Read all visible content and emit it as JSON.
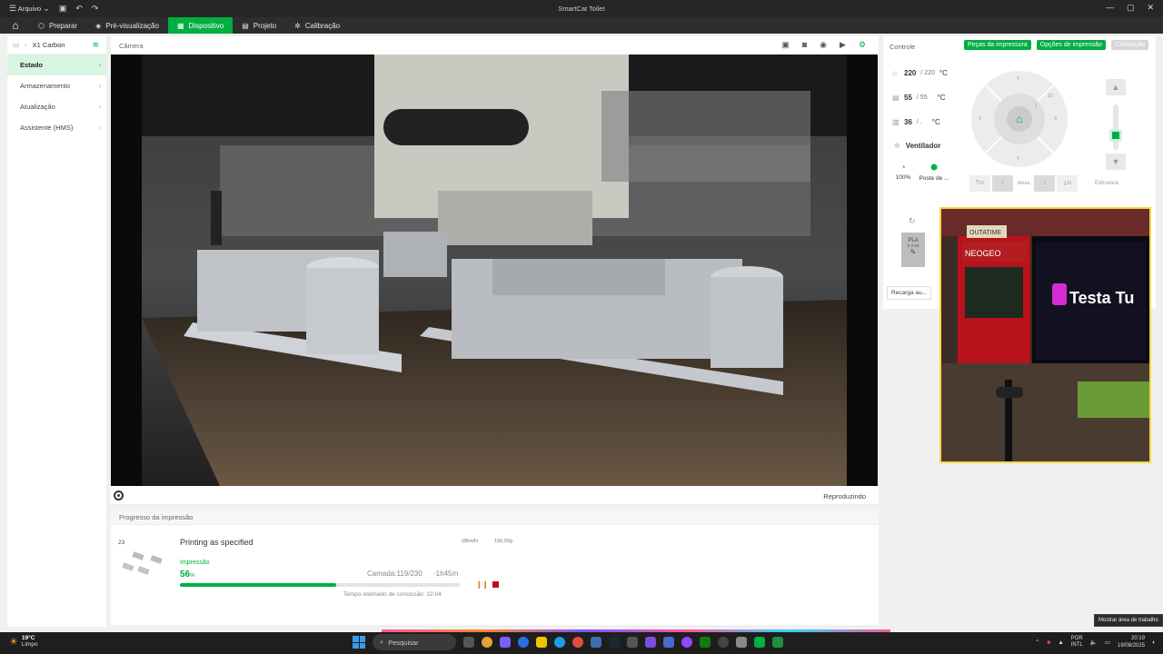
{
  "window": {
    "title": "SmartCat Toilet",
    "menu_label": "Arquivo"
  },
  "nav": {
    "tabs": [
      {
        "label": "Preparar"
      },
      {
        "label": "Pré-visualização"
      },
      {
        "label": "Dispositivo"
      },
      {
        "label": "Projeto"
      },
      {
        "label": "Calibração"
      }
    ],
    "active_tab": "Dispositivo"
  },
  "sidebar": {
    "device_name": "X1 Carbon",
    "items": [
      {
        "label": "Estado"
      },
      {
        "label": "Armazenamento"
      },
      {
        "label": "Atualização"
      },
      {
        "label": "Assistente (HMS)"
      }
    ]
  },
  "camera": {
    "title": "Câmera",
    "status": "Reproduzindo",
    "icons": [
      "snapshot-icon",
      "record-icon",
      "camera-switch-icon",
      "timelapse-icon",
      "settings-icon"
    ]
  },
  "progress": {
    "title": "Progresso da impressão",
    "plate_number": "23",
    "job_name": "Printing as specified",
    "meta_length": "(86m/fs",
    "meta_weight": "156,93g",
    "phase_label": "Impressão",
    "percent_value": "56",
    "percent_unit": "%",
    "percent": 56,
    "layer_text": "Camada:119/230",
    "remaining": "-1h45m",
    "eta": "Tempo estimado de conclusão: 22:04"
  },
  "controls": {
    "title": "Controle",
    "buttons": {
      "parts": "Peças da impressora",
      "options": "Opções de impressão",
      "calibration": "Calibração"
    },
    "nozzle": {
      "current": "220",
      "target": "/ 220",
      "unit": "°C"
    },
    "bed": {
      "current": "55",
      "target": "/ 55",
      "unit": "°C"
    },
    "chamber": {
      "current": "36",
      "target": "/ .",
      "unit": "°C"
    },
    "fan_title": "Ventilador",
    "fan_speed": "100%",
    "fan_mode": "Poste de ...",
    "bed_label": "Mesa",
    "bed_steps": [
      "10",
      "1",
      "1",
      "10"
    ],
    "extruder_label": "Extrusora",
    "jog_labels": [
      "Y",
      "X",
      "10",
      "1",
      "X",
      "Y"
    ]
  },
  "ams": {
    "slot_material": "PLA",
    "slot_color_code": "K 0.00",
    "recharge_label": "Recarga au..."
  },
  "webcam_overlay": {
    "sign_text": "Testa Tu",
    "arcade_label": "NEOGEO",
    "marquee": "OUTATIME"
  },
  "taskbar": {
    "weather_temp": "19°C",
    "weather_desc": "Limpo",
    "search_placeholder": "Pesquisar",
    "lang_line1": "POR",
    "lang_line2": "INTL",
    "time": "20:19",
    "date": "19/08/2025",
    "tooltip": "Mostrar área de trabalho"
  }
}
